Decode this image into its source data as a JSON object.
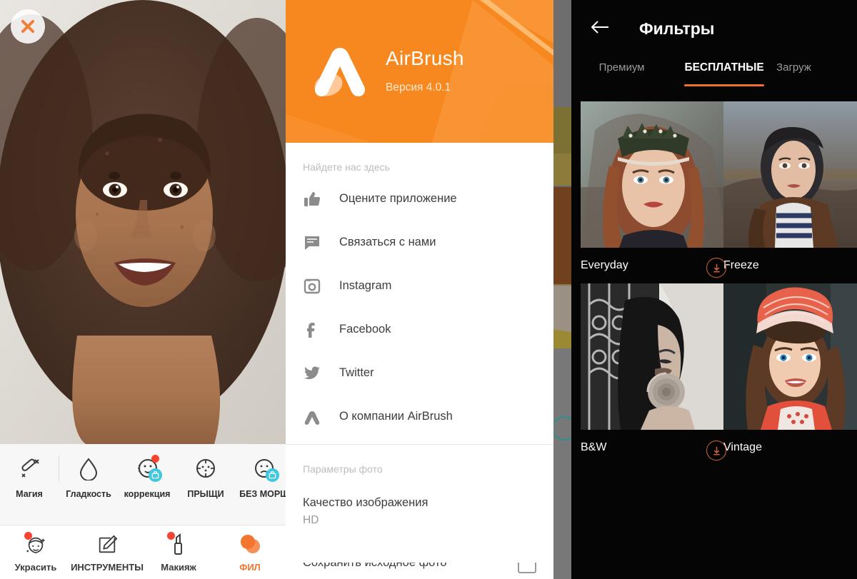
{
  "editor": {
    "close_label": "Закрыть",
    "tools": [
      {
        "label": "Магия",
        "icon": "magic-wand-icon",
        "badge": false,
        "shop": false
      },
      {
        "label": "Гладкость",
        "icon": "droplet-icon",
        "badge": false,
        "shop": false
      },
      {
        "label": "коррекция",
        "icon": "face-fix-icon",
        "badge": true,
        "shop": true
      },
      {
        "label": "ПРЫЩИ",
        "icon": "blemish-icon",
        "badge": false,
        "shop": false
      },
      {
        "label": "БЕЗ МОРЩ",
        "icon": "wrinkle-icon",
        "badge": false,
        "shop": true
      }
    ],
    "nav": [
      {
        "label": "Украсить",
        "icon": "beautify-icon",
        "badge": true,
        "active": false
      },
      {
        "label": "ИНСТРУМЕНТЫ",
        "icon": "edit-pencil-icon",
        "badge": false,
        "active": false
      },
      {
        "label": "Макияж",
        "icon": "lipstick-icon",
        "badge": true,
        "active": false
      },
      {
        "label": "ФИЛ",
        "icon": "filters-icon",
        "badge": false,
        "active": true
      }
    ]
  },
  "drawer": {
    "app_name": "AirBrush",
    "version": "Версия 4.0.1",
    "logo_icon": "airbrush-logo-icon",
    "section_social": "Найдете нас здесь",
    "items": [
      {
        "label": "Оцените приложение",
        "icon": "thumbs-up-icon"
      },
      {
        "label": "Связаться с нами",
        "icon": "chat-bubble-icon"
      },
      {
        "label": "Instagram",
        "icon": "instagram-icon"
      },
      {
        "label": "Facebook",
        "icon": "facebook-icon"
      },
      {
        "label": "Twitter",
        "icon": "twitter-icon"
      },
      {
        "label": "О компании AirBrush",
        "icon": "airbrush-logo-icon"
      }
    ],
    "section_photo": "Параметры фото",
    "quality_title": "Качество изображения",
    "quality_value": "HD",
    "save_original_label": "Сохранить исходное фото"
  },
  "filters": {
    "back_icon": "back-arrow-icon",
    "title": "Фильтры",
    "tabs": [
      {
        "label": "Премиум",
        "active": false
      },
      {
        "label": "БЕСПЛАТНЫЕ",
        "active": true
      },
      {
        "label": "Загруж",
        "active": false
      }
    ],
    "items": [
      {
        "label": "Everyday",
        "download": false,
        "thumb": "crown-portrait-thumb"
      },
      {
        "label": "Freeze",
        "download": true,
        "thumb": "street-portrait-thumb"
      },
      {
        "label": "B&W",
        "download": false,
        "thumb": "bw-rose-portrait-thumb"
      },
      {
        "label": "Vintage",
        "download": true,
        "thumb": "knit-hat-portrait-thumb"
      }
    ]
  },
  "colors": {
    "accent_orange": "#f7881f",
    "tab_underline": "#ef7034",
    "badge_red": "#f8432f",
    "shop_cyan": "#3fc9e0",
    "filters_active": "#f2762e"
  }
}
